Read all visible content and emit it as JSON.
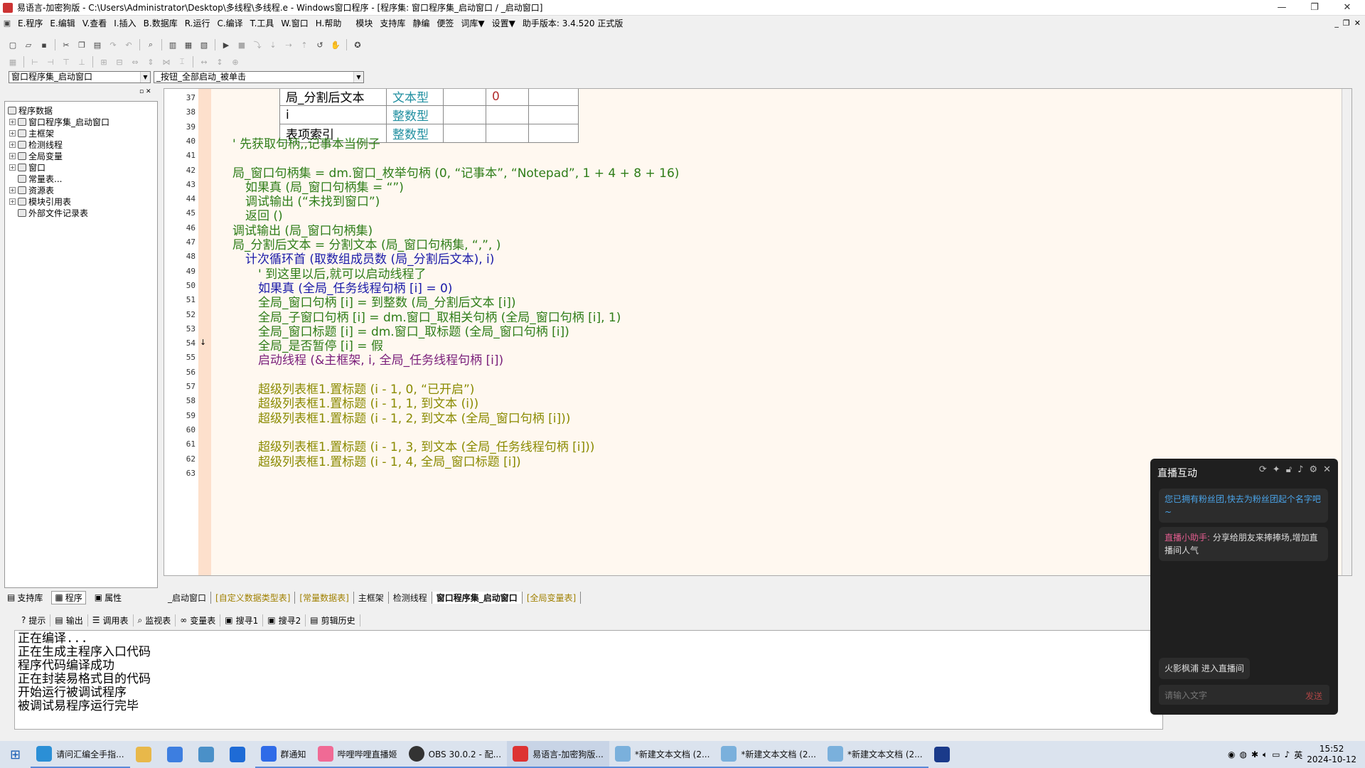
{
  "window": {
    "title": "易语言-加密狗版 - C:\\Users\\Administrator\\Desktop\\多线程\\多线程.e - Windows窗口程序 - [程序集: 窗口程序集_启动窗口 / _启动窗口]",
    "min": "—",
    "max": "❐",
    "close": "✕"
  },
  "menu": [
    "E.程序",
    "E.编辑",
    "V.查看",
    "I.插入",
    "B.数据库",
    "R.运行",
    "C.编译",
    "T.工具",
    "W.窗口",
    "H.帮助",
    "模块",
    "支持库",
    "静编",
    "便签",
    "词库▼",
    "设置▼",
    "助手版本: 3.4.520 正式版"
  ],
  "combos": {
    "left": "窗口程序集_启动窗口",
    "right": "_按钮_全部启动_被单击"
  },
  "tree": {
    "root": "程序数据",
    "items": [
      "窗口程序集_启动窗口",
      "主框架",
      "检测线程",
      "全局变量",
      "窗口",
      "常量表...",
      "资源表",
      "模块引用表",
      "外部文件记录表"
    ]
  },
  "left_tabs": [
    "支持库",
    "程序",
    "属性"
  ],
  "table_rows": [
    {
      "line": "37",
      "name": "局_分割后文本",
      "type": "文本型",
      "c3": "",
      "c4": "0",
      "c5": ""
    },
    {
      "line": "38",
      "name": "i",
      "type": "整数型",
      "c3": "",
      "c4": "",
      "c5": ""
    },
    {
      "line": "39",
      "name": "表项索引",
      "type": "整数型",
      "c3": "",
      "c4": "",
      "c5": ""
    }
  ],
  "code_lines": [
    {
      "line": "40",
      "text": "' 先获取句柄,,记事本当例子"
    },
    {
      "line": "41",
      "text": ""
    },
    {
      "line": "42",
      "text": "局_窗口句柄集 = dm.窗口_枚举句柄 (0, “记事本”, “Notepad”, 1 + 4 + 8 + 16)"
    },
    {
      "line": "43",
      "text": "如果真 (局_窗口句柄集 = “”)"
    },
    {
      "line": "44",
      "text": "调试输出 (“未找到窗口”)"
    },
    {
      "line": "45",
      "text": "返回 ()"
    },
    {
      "line": "46",
      "text": "调试输出 (局_窗口句柄集)"
    },
    {
      "line": "47",
      "text": "局_分割后文本 = 分割文本 (局_窗口句柄集, “,”, )"
    },
    {
      "line": "48",
      "text": "计次循环首 (取数组成员数 (局_分割后文本), i)"
    },
    {
      "line": "49",
      "text": "' 到这里以后,就可以启动线程了"
    },
    {
      "line": "50",
      "text": "如果真 (全局_任务线程句柄 [i] = 0)"
    },
    {
      "line": "51",
      "text": "全局_窗口句柄 [i] = 到整数 (局_分割后文本 [i])"
    },
    {
      "line": "52",
      "text": "全局_子窗口句柄 [i] = dm.窗口_取相关句柄 (全局_窗口句柄 [i], 1)"
    },
    {
      "line": "53",
      "text": "全局_窗口标题 [i] = dm.窗口_取标题 (全局_窗口句柄 [i])"
    },
    {
      "line": "54",
      "text": "全局_是否暂停 [i] = 假"
    },
    {
      "line": "55",
      "text": "启动线程 (&主框架, i, 全局_任务线程句柄 [i])"
    },
    {
      "line": "56",
      "text": ""
    },
    {
      "line": "57",
      "text": "超级列表框1.置标题 (i - 1, 0, “已开启”)"
    },
    {
      "line": "58",
      "text": "超级列表框1.置标题 (i - 1, 1, 到文本 (i))"
    },
    {
      "line": "59",
      "text": "超级列表框1.置标题 (i - 1, 2, 到文本 (全局_窗口句柄 [i]))"
    },
    {
      "line": "60",
      "text": ""
    },
    {
      "line": "61",
      "text": "超级列表框1.置标题 (i - 1, 3, 到文本 (全局_任务线程句柄 [i]))"
    },
    {
      "line": "62",
      "text": "超级列表框1.置标题 (i - 1, 4, 全局_窗口标题 [i])"
    },
    {
      "line": "63",
      "text": ""
    }
  ],
  "editor_tabs": [
    "_启动窗口",
    "[自定义数据类型表]",
    "[常量数据表]",
    "主框架",
    "检测线程",
    "窗口程序集_启动窗口",
    "[全局变量表]"
  ],
  "bottom_tabs": [
    "提示",
    "输出",
    "调用表",
    "监视表",
    "变量表",
    "搜寻1",
    "搜寻2",
    "剪辑历史"
  ],
  "output_lines": [
    "正在编译...",
    "正在生成主程序入口代码",
    "程序代码编译成功",
    "正在封装易格式目的代码",
    "开始运行被调试程序",
    "被调试易程序运行完毕"
  ],
  "live": {
    "title": "直播互动",
    "msg1": "您已拥有粉丝团,快去为粉丝团起个名字吧~",
    "msg2_name": "直播小助手:",
    "msg2_text": " 分享给朋友来捧捧场,增加直播间人气",
    "msg3": "火影枫浦 进入直播间",
    "placeholder": "请输入文字",
    "send": "发送"
  },
  "taskbar": {
    "items": [
      "请问汇编全手指...",
      "",
      "",
      "",
      "",
      "群通知",
      "哔哩哔哩直播姬",
      "OBS 30.0.2 - 配...",
      "易语言-加密狗版...",
      "*新建文本文档 (2...",
      "*新建文本文档 (2...",
      "*新建文本文档 (2..."
    ],
    "ime": "英",
    "time": "15:52",
    "date": "2024-10-12"
  }
}
